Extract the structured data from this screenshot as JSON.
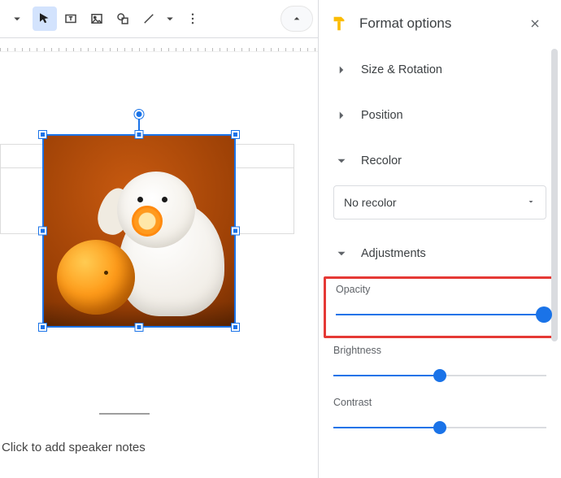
{
  "panel": {
    "title": "Format options",
    "sections": {
      "size": "Size & Rotation",
      "position": "Position",
      "recolor": "Recolor",
      "adjustments": "Adjustments"
    },
    "recolor_value": "No recolor",
    "sliders": {
      "opacity": {
        "label": "Opacity",
        "value": 100,
        "min": 0,
        "max": 100
      },
      "brightness": {
        "label": "Brightness",
        "value": 50,
        "min": 0,
        "max": 100
      },
      "contrast": {
        "label": "Contrast",
        "value": 50,
        "min": 0,
        "max": 100
      }
    }
  },
  "canvas": {
    "speaker_placeholder": "Click to add speaker notes",
    "selected_image_alt": "White fluffy dog holding an orange slice next to an orange on an orange background"
  },
  "colors": {
    "accent": "#1a73e8",
    "highlight": "#e53935"
  }
}
